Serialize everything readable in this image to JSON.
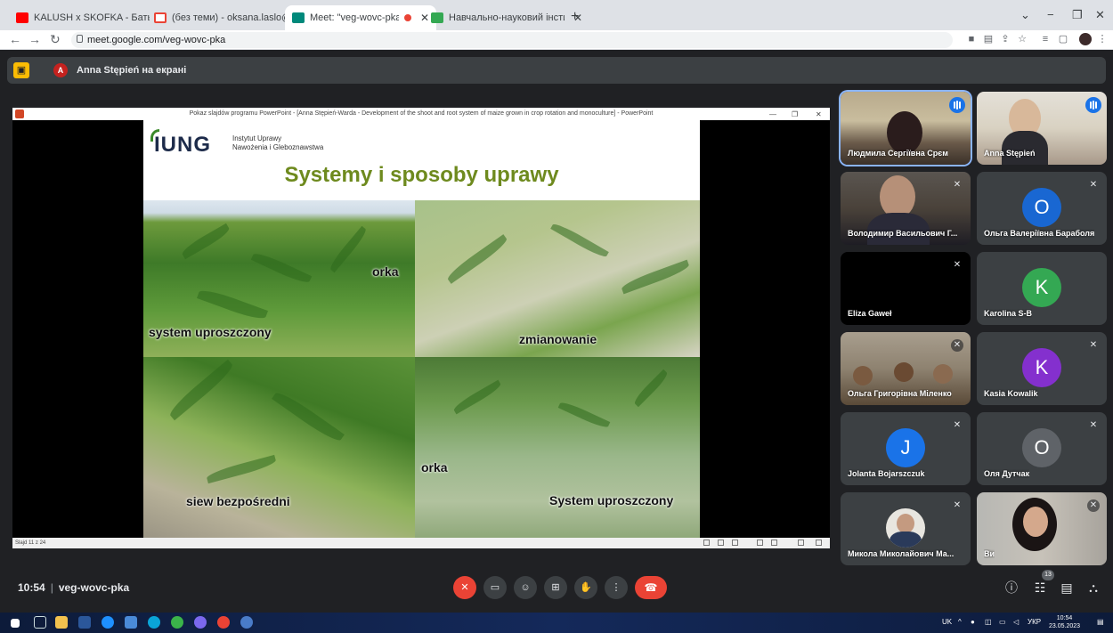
{
  "browser": {
    "tabs": [
      {
        "title": "KALUSH x SKOFKA - Батьківщин",
        "favicon_color": "#ff0000",
        "active": false
      },
      {
        "title": "(без теми) - oksana.laslo@pdaa",
        "favicon_color": "#ea4335",
        "active": false
      },
      {
        "title": "Meet: \"veg-wovc-pka\"",
        "favicon_color": "#00897b",
        "active": true
      },
      {
        "title": "Навчально-науковий інститут а",
        "favicon_color": "#34a853",
        "active": false
      }
    ],
    "url": "meet.google.com/veg-wovc-pka"
  },
  "banner": {
    "avatar_letter": "A",
    "text": "Anna Stępień на екрані"
  },
  "presentation": {
    "window_title": "Pokaz slajdów programu PowerPoint - [Anna Stępień-Warda - Development of the shoot and root system of maize grown in crop rotation and monoculture] - PowerPoint",
    "slide_counter": "Slajd 11 z 24",
    "logo": "IUNG",
    "institute_line1": "Instytut Uprawy",
    "institute_line2": "Nawożenia i Gleboznawstwa",
    "slide_title": "Systemy i sposoby uprawy",
    "labels": {
      "orka_top": "orka",
      "system_uproszczony_left": "system uproszczony",
      "zmianowanie": "zmianowanie",
      "orka_bottom": "orka",
      "siew_bezposredni": "siew bezpośredni",
      "system_uproszczony_right": "System uproszczony"
    }
  },
  "participants": [
    {
      "name": "Людмила Сергіївна Срєм",
      "camera": "room",
      "speaking": true
    },
    {
      "name": "Anna Stępień",
      "camera": "office",
      "talking": true
    },
    {
      "name": "Володимир Васильович Г...",
      "camera": "man",
      "muted": true
    },
    {
      "name": "Ольга Валеріївна Бараболя",
      "avatar_letter": "O",
      "avatar_color": "#1967d2",
      "muted": true
    },
    {
      "name": "Eliza Gaweł",
      "camera": "black",
      "muted": true
    },
    {
      "name": "Karolina S-B",
      "avatar_letter": "K",
      "avatar_color": "#34a853"
    },
    {
      "name": "Ольга Григорівна Міленко",
      "camera": "meeting",
      "muted": true
    },
    {
      "name": "Kasia Kowalik",
      "avatar_letter": "K",
      "avatar_color": "#8430ce",
      "muted": true
    },
    {
      "name": "Jolanta Bojarszczuk",
      "avatar_letter": "J",
      "avatar_color": "#1a73e8",
      "muted": true
    },
    {
      "name": "Оля Дутчак",
      "avatar_letter": "O",
      "avatar_color": "#5f6368",
      "muted": true
    },
    {
      "name": "Микола Миколайович Ма...",
      "avatar_photo": true,
      "muted": true
    },
    {
      "name": "Ви",
      "camera": "woman",
      "muted": true
    }
  ],
  "meeting": {
    "time": "10:54",
    "code": "veg-wovc-pka",
    "people_count": "13"
  },
  "taskbar": {
    "lang": "UK",
    "lang2": "УКР",
    "clock_time": "10:54",
    "clock_date": "23.05.2023"
  }
}
